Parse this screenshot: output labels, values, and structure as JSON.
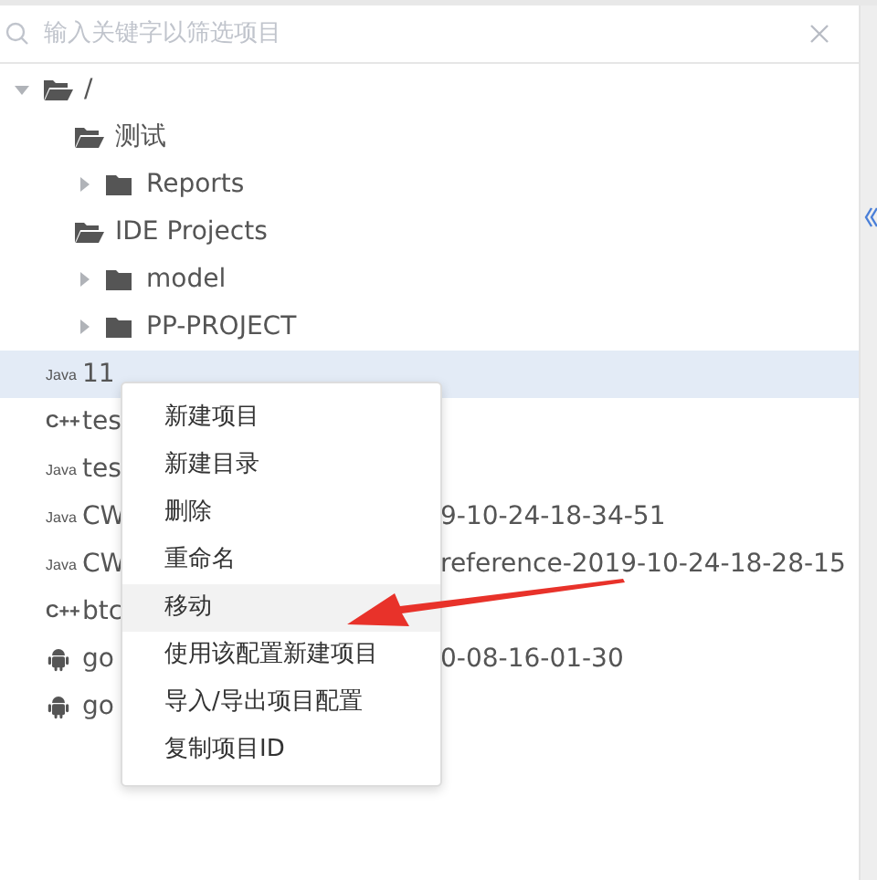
{
  "search": {
    "placeholder": "输入关键字以筛选项目"
  },
  "tree": [
    {
      "kind": "folder",
      "label": "/",
      "arrow": true,
      "expanded": true,
      "selected": false,
      "children": [
        {
          "kind": "folder",
          "label": "测试",
          "arrow": false,
          "expanded": true,
          "selected": false,
          "children": [
            {
              "kind": "folder",
              "label": "Reports",
              "arrow": true,
              "expanded": false,
              "selected": false
            }
          ]
        },
        {
          "kind": "folder",
          "label": "IDE Projects",
          "arrow": false,
          "expanded": true,
          "selected": false,
          "children": [
            {
              "kind": "folder",
              "label": "model",
              "arrow": true,
              "expanded": false,
              "selected": false
            },
            {
              "kind": "folder",
              "label": "PP-PROJECT",
              "arrow": true,
              "expanded": false,
              "selected": false
            }
          ]
        },
        {
          "kind": "java",
          "badge": "Java",
          "label": "11",
          "selected": true
        },
        {
          "kind": "cpp",
          "badge": "C++",
          "label": "tes",
          "selected": false
        },
        {
          "kind": "java",
          "badge": "Java",
          "label": "tes",
          "selected": false
        },
        {
          "kind": "java",
          "badge": "Java",
          "label": "CW",
          "tail": "9-10-24-18-34-51",
          "selected": false
        },
        {
          "kind": "java",
          "badge": "Java",
          "label": "CW",
          "tail": "reference-2019-10-24-18-28-15",
          "selected": false
        },
        {
          "kind": "cpp",
          "badge": "C++",
          "label": "btc",
          "selected": false
        },
        {
          "kind": "android",
          "label": "go",
          "tail": "0-08-16-01-30",
          "selected": false
        },
        {
          "kind": "android",
          "label": "go",
          "selected": false
        }
      ]
    }
  ],
  "context_menu": [
    {
      "label": "新建项目",
      "selected": false
    },
    {
      "label": "新建目录",
      "selected": false
    },
    {
      "label": "删除",
      "selected": false
    },
    {
      "label": "重命名",
      "selected": false
    },
    {
      "label": "移动",
      "selected": true
    },
    {
      "label": "使用该配置新建项目",
      "selected": false
    },
    {
      "label": "导入/导出项目配置",
      "selected": false
    },
    {
      "label": "复制项目ID",
      "selected": false
    }
  ]
}
